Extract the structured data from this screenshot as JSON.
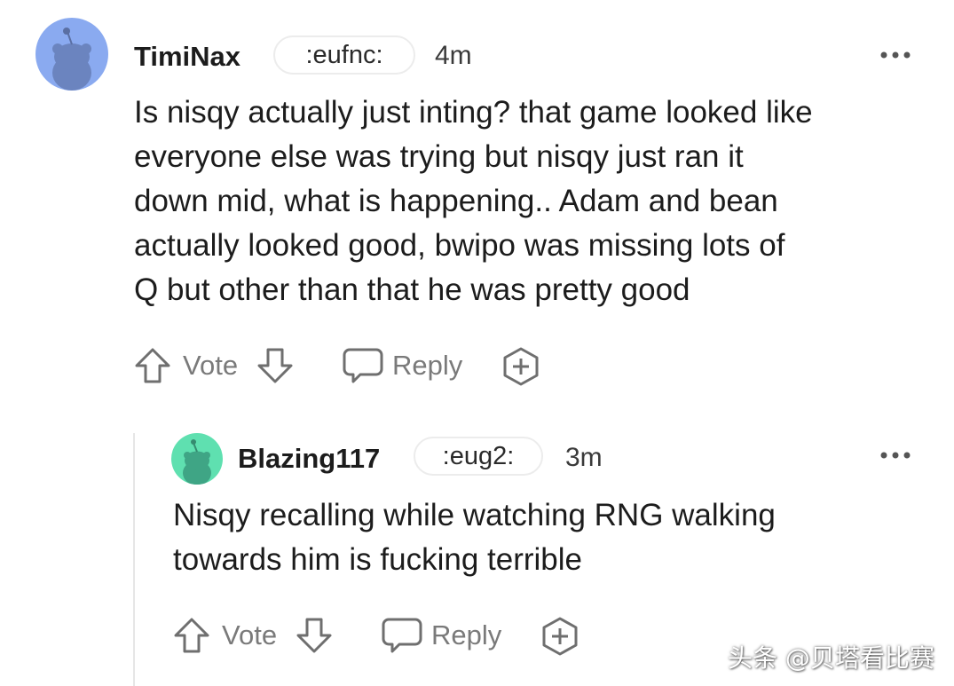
{
  "comments": [
    {
      "username": "TimiNax",
      "flair": ":eufnc:",
      "time": "4m",
      "more": "•••",
      "avatar_color": "#8aaaf0",
      "lines": [
        "Is nisqy actually just inting? that game looked like",
        "everyone else was trying but nisqy just ran it",
        "down mid, what is happening.. Adam and bean",
        "actually looked good, bwipo was missing lots of",
        "Q but other than that he was pretty good"
      ],
      "actions": {
        "vote": "Vote",
        "reply": "Reply"
      }
    },
    {
      "username": "Blazing117",
      "flair": ":eug2:",
      "time": "3m",
      "more": "•••",
      "avatar_color": "#5fe0b0",
      "lines": [
        "Nisqy recalling while watching RNG walking",
        "towards him is fucking terrible"
      ],
      "actions": {
        "vote": "Vote",
        "reply": "Reply"
      }
    }
  ],
  "watermark": "头条 @贝塔看比赛",
  "colors": {
    "icon": "#6f6f6f",
    "text": "#1c1c1c",
    "muted": "#7a7a7a",
    "thread_line": "#e6e6e6"
  },
  "icons": [
    "upvote-arrow-icon",
    "downvote-arrow-icon",
    "comment-bubble-icon",
    "award-plus-icon",
    "overflow-dots-icon"
  ]
}
